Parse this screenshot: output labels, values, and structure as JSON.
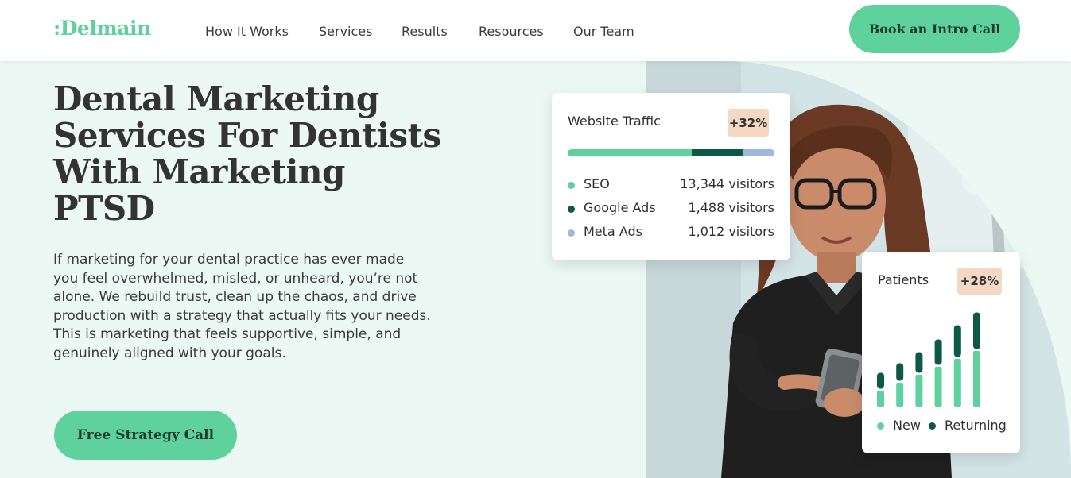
{
  "header": {
    "logo": ":Delmain",
    "nav": [
      {
        "label": "How It Works"
      },
      {
        "label": "Services"
      },
      {
        "label": "Results"
      },
      {
        "label": "Resources"
      },
      {
        "label": "Our Team"
      }
    ],
    "cta_label": "Book an Intro Call"
  },
  "hero": {
    "title_lines": [
      "Dental Marketing",
      "Services For Dentists",
      "With Marketing",
      "PTSD"
    ],
    "body_lines": [
      "If marketing for your dental practice has ever made",
      "you feel overwhelmed, misled, or unheard, you’re not",
      "alone. We rebuild trust, clean up the chaos, and drive",
      "production with a strategy that actually fits your needs.",
      "This is marketing that feels supportive, simple, and",
      "genuinely aligned with your goals."
    ],
    "cta_label": "Free Strategy Call"
  },
  "traffic_card": {
    "title": "Website Traffic",
    "badge": "+32%",
    "sources": [
      {
        "name": "SEO",
        "value": "13,344 visitors",
        "count": 13344,
        "color": "#5ed19c"
      },
      {
        "name": "Google Ads",
        "value": "1,488 visitors",
        "count": 1488,
        "color": "#0c5a46"
      },
      {
        "name": "Meta Ads",
        "value": "1,012 visitors",
        "count": 1012,
        "color": "#9fb8dc"
      }
    ],
    "bar_shares": [
      0.6,
      0.25,
      0.15
    ]
  },
  "patients_card": {
    "title": "Patients",
    "badge": "+28%",
    "legend_new": "New",
    "legend_returning": "Returning",
    "colors": {
      "new": "#5ed19c",
      "returning": "#0c5a46"
    },
    "bars": [
      {
        "new": 20,
        "returning": 20
      },
      {
        "new": 30,
        "returning": 22
      },
      {
        "new": 40,
        "returning": 26
      },
      {
        "new": 50,
        "returning": 32
      },
      {
        "new": 60,
        "returning": 40
      },
      {
        "new": 70,
        "returning": 46
      }
    ]
  },
  "colors": {
    "accent": "#5ed19c",
    "dark_green": "#0c5a46",
    "hero_bg": "#ecf8f3",
    "badge_bg": "#f3d9c3"
  }
}
